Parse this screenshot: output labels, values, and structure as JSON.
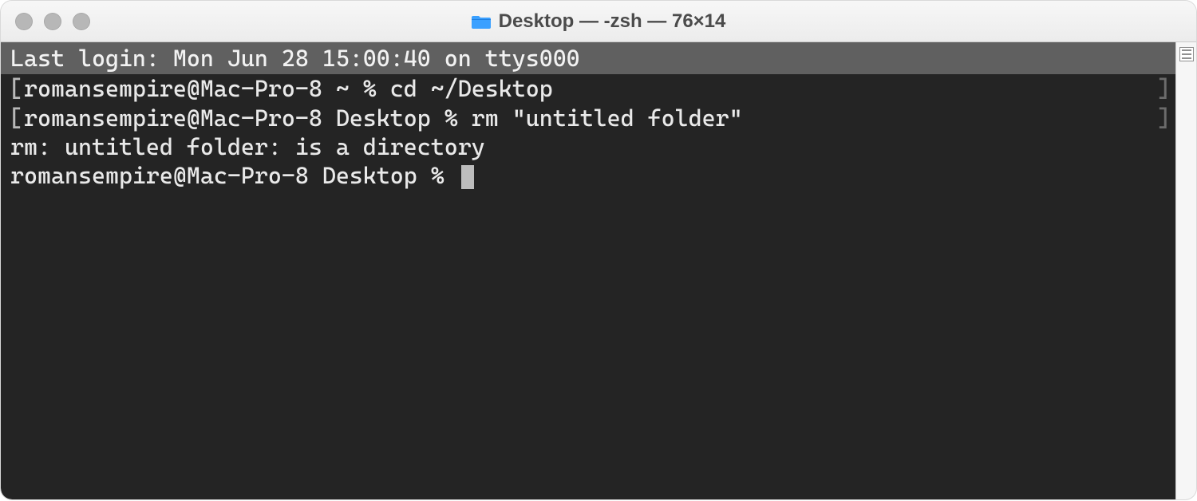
{
  "window": {
    "title": "Desktop — -zsh — 76×14"
  },
  "terminal": {
    "last_login": "Last login: Mon Jun 28 15:00:40 on ttys000",
    "lines": [
      {
        "prompt": "romansempire@Mac-Pro-8 ~ % ",
        "command": "cd ~/Desktop"
      },
      {
        "prompt": "romansempire@Mac-Pro-8 Desktop % ",
        "command": "rm \"untitled folder\""
      }
    ],
    "output": "rm: untitled folder: is a directory",
    "current_prompt": "romansempire@Mac-Pro-8 Desktop % "
  },
  "icons": {
    "folder": "folder-icon"
  },
  "colors": {
    "terminal_bg": "#242424",
    "terminal_fg": "#e9e9e9",
    "titlebar_bg": "#f0f0f0"
  }
}
